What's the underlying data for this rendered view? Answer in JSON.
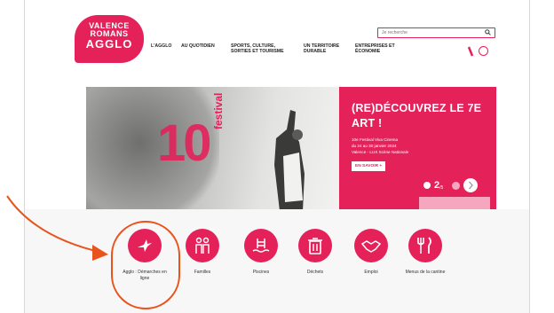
{
  "logo": {
    "line1": "VALENCE",
    "line2": "ROMANS",
    "line3": "AGGLO"
  },
  "nav": {
    "items": [
      {
        "label": "L'AGGLO"
      },
      {
        "label": "AU QUOTIDIEN"
      },
      {
        "label": "SPORTS, CULTURE, SORTIES ET TOURISME"
      },
      {
        "label": "UN TERRITOIRE DURABLE"
      },
      {
        "label": "ENTREPRISES ET ÉCONOMIE"
      }
    ]
  },
  "search": {
    "placeholder": "Je recherche"
  },
  "hero": {
    "ten": "10",
    "fest": "festival",
    "title": "(RE)DÉCOUVREZ LE 7E ART !",
    "sub1": "10e Festival Viva Cinema",
    "sub2": "du 24 au 30 janvier 2024",
    "sub3": "Valence - LUX Scène Nationale",
    "button": "EN SAVOIR +",
    "slide": "2",
    "slide_total": "/5"
  },
  "services": [
    {
      "label": "Agglo : Démarches en ligne",
      "icon": "bird-icon"
    },
    {
      "label": "Familles",
      "icon": "family-icon"
    },
    {
      "label": "Piscines",
      "icon": "pool-icon"
    },
    {
      "label": "Déchets",
      "icon": "trash-icon"
    },
    {
      "label": "Emploi",
      "icon": "handshake-icon"
    },
    {
      "label": "Menus de la cantine",
      "icon": "cutlery-icon"
    }
  ],
  "colors": {
    "brand": "#e5215a",
    "annotation": "#e8541c"
  }
}
